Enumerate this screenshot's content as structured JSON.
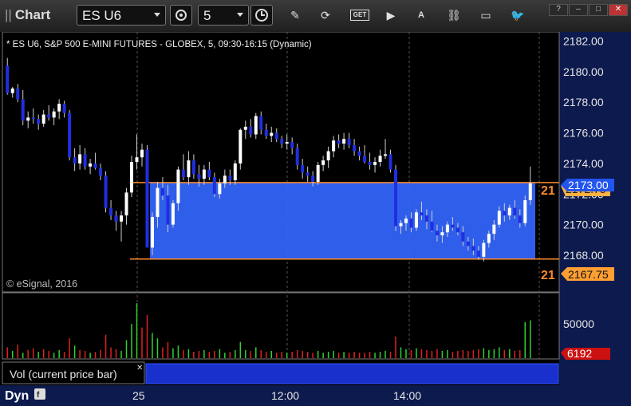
{
  "app": {
    "title": "Chart",
    "grip": "||"
  },
  "toolbar": {
    "symbol": "ES U6",
    "interval": "5",
    "icons": [
      "settings-icon",
      "clock-icon",
      "pencil-icon",
      "refresh-icon",
      "get-icon",
      "play-icon",
      "alert-icon",
      "link-icon",
      "comment-icon",
      "twitter-icon"
    ],
    "get_label": "GET",
    "alert_label": "A"
  },
  "window_buttons": [
    "?",
    "–",
    "□",
    "✕"
  ],
  "chart_header": "* ES U6, S&P 500 E-MINI FUTURES - GLOBEX, 5, 09:30-16:15 (Dynamic)",
  "copyright": "© eSignal, 2016",
  "chart_data": {
    "type": "candlestick",
    "price_axis": {
      "ticks": [
        "2182.00",
        "2180.00",
        "2178.00",
        "2176.00",
        "2174.00",
        "2172.00",
        "2170.00",
        "2168.00"
      ],
      "range": [
        2165.6,
        2182.6
      ]
    },
    "last_price": "2173.00",
    "prior_price_tag": "2172.75",
    "lower_line_label": "2167.75",
    "line_prefix": "21",
    "time_axis": [
      "25",
      "12:00",
      "14:00"
    ],
    "zone": {
      "top": 2172.75,
      "bottom": 2167.75,
      "color": "#3366ff"
    },
    "candles": [
      [
        2180.4,
        2180.9,
        2178.5,
        2178.6
      ],
      [
        2178.6,
        2179.0,
        2178.3,
        2178.9
      ],
      [
        2178.9,
        2179.2,
        2178.0,
        2178.2
      ],
      [
        2178.2,
        2178.8,
        2176.5,
        2176.8
      ],
      [
        2176.8,
        2177.4,
        2176.3,
        2177.0
      ],
      [
        2177.0,
        2177.6,
        2176.6,
        2176.9
      ],
      [
        2176.9,
        2177.2,
        2176.2,
        2176.6
      ],
      [
        2176.6,
        2177.5,
        2176.4,
        2177.2
      ],
      [
        2177.2,
        2177.8,
        2176.8,
        2177.0
      ],
      [
        2177.0,
        2177.6,
        2176.5,
        2177.4
      ],
      [
        2177.4,
        2178.2,
        2176.9,
        2177.9
      ],
      [
        2177.9,
        2178.1,
        2177.0,
        2177.3
      ],
      [
        2177.3,
        2177.5,
        2174.2,
        2174.4
      ],
      [
        2174.4,
        2175.0,
        2173.5,
        2174.0
      ],
      [
        2174.0,
        2175.2,
        2173.6,
        2174.6
      ],
      [
        2174.6,
        2175.0,
        2173.6,
        2173.8
      ],
      [
        2173.8,
        2174.3,
        2173.3,
        2174.0
      ],
      [
        2174.0,
        2174.7,
        2173.6,
        2173.7
      ],
      [
        2173.7,
        2174.0,
        2172.9,
        2173.2
      ],
      [
        2173.2,
        2173.5,
        2170.8,
        2171.1
      ],
      [
        2171.1,
        2171.6,
        2170.3,
        2170.6
      ],
      [
        2170.6,
        2170.9,
        2169.6,
        2170.2
      ],
      [
        2170.2,
        2170.9,
        2168.9,
        2170.6
      ],
      [
        2170.6,
        2172.4,
        2170.0,
        2172.1
      ],
      [
        2172.1,
        2174.5,
        2171.8,
        2174.1
      ],
      [
        2174.1,
        2175.9,
        2173.6,
        2174.4
      ],
      [
        2174.4,
        2175.3,
        2173.8,
        2174.9
      ],
      [
        2174.9,
        2175.2,
        2171.9,
        2168.5
      ],
      [
        2168.5,
        2170.8,
        2168.0,
        2170.5
      ],
      [
        2170.5,
        2172.8,
        2169.8,
        2172.4
      ],
      [
        2172.4,
        2173.1,
        2171.6,
        2171.9
      ],
      [
        2171.9,
        2172.6,
        2169.5,
        2170.0
      ],
      [
        2170.0,
        2171.6,
        2169.8,
        2171.4
      ],
      [
        2171.4,
        2173.8,
        2170.9,
        2173.6
      ],
      [
        2173.6,
        2174.6,
        2172.9,
        2173.1
      ],
      [
        2173.1,
        2174.8,
        2172.6,
        2174.2
      ],
      [
        2174.2,
        2174.6,
        2173.0,
        2173.3
      ],
      [
        2173.3,
        2173.9,
        2172.5,
        2173.0
      ],
      [
        2173.0,
        2173.9,
        2172.6,
        2173.6
      ],
      [
        2173.6,
        2174.1,
        2172.9,
        2173.1
      ],
      [
        2173.1,
        2173.4,
        2171.8,
        2172.0
      ],
      [
        2172.0,
        2173.0,
        2171.7,
        2172.7
      ],
      [
        2172.7,
        2173.6,
        2172.4,
        2173.2
      ],
      [
        2173.2,
        2173.6,
        2172.6,
        2172.9
      ],
      [
        2172.9,
        2174.2,
        2172.6,
        2174.0
      ],
      [
        2174.0,
        2176.3,
        2173.6,
        2176.2
      ],
      [
        2176.2,
        2176.8,
        2175.6,
        2176.4
      ],
      [
        2176.4,
        2176.9,
        2175.7,
        2175.9
      ],
      [
        2175.9,
        2177.3,
        2175.6,
        2177.1
      ],
      [
        2177.1,
        2177.4,
        2175.9,
        2176.2
      ],
      [
        2176.2,
        2176.6,
        2175.6,
        2175.8
      ],
      [
        2175.8,
        2176.4,
        2175.4,
        2176.0
      ],
      [
        2176.0,
        2176.3,
        2175.4,
        2175.6
      ],
      [
        2175.6,
        2175.8,
        2175.0,
        2175.3
      ],
      [
        2175.3,
        2175.9,
        2174.9,
        2175.4
      ],
      [
        2175.4,
        2175.7,
        2174.6,
        2175.0
      ],
      [
        2175.0,
        2175.3,
        2173.6,
        2173.9
      ],
      [
        2173.9,
        2174.3,
        2173.0,
        2173.4
      ],
      [
        2173.4,
        2173.8,
        2172.8,
        2173.2
      ],
      [
        2173.2,
        2173.5,
        2172.5,
        2172.8
      ],
      [
        2172.8,
        2174.1,
        2172.6,
        2173.9
      ],
      [
        2173.9,
        2174.5,
        2173.5,
        2174.2
      ],
      [
        2174.2,
        2175.1,
        2173.7,
        2174.8
      ],
      [
        2174.8,
        2175.8,
        2174.4,
        2175.5
      ],
      [
        2175.5,
        2175.9,
        2175.0,
        2175.3
      ],
      [
        2175.3,
        2176.0,
        2174.9,
        2175.6
      ],
      [
        2175.6,
        2176.0,
        2175.0,
        2175.2
      ],
      [
        2175.2,
        2175.6,
        2174.5,
        2174.8
      ],
      [
        2174.8,
        2175.1,
        2174.2,
        2174.5
      ],
      [
        2174.5,
        2175.2,
        2174.0,
        2174.1
      ],
      [
        2174.1,
        2174.7,
        2173.6,
        2173.9
      ],
      [
        2173.9,
        2174.4,
        2173.4,
        2174.1
      ],
      [
        2174.1,
        2174.9,
        2173.8,
        2174.5
      ],
      [
        2174.5,
        2175.6,
        2174.3,
        2174.6
      ],
      [
        2174.6,
        2174.9,
        2173.4,
        2173.6
      ],
      [
        2173.6,
        2173.9,
        2169.6,
        2169.9
      ],
      [
        2169.9,
        2170.3,
        2169.4,
        2170.1
      ],
      [
        2170.1,
        2170.6,
        2169.6,
        2170.4
      ],
      [
        2170.4,
        2170.8,
        2169.5,
        2169.8
      ],
      [
        2169.8,
        2171.0,
        2169.6,
        2170.8
      ],
      [
        2170.8,
        2171.5,
        2170.3,
        2170.6
      ],
      [
        2170.6,
        2171.0,
        2169.7,
        2170.2
      ],
      [
        2170.2,
        2170.9,
        2169.5,
        2169.6
      ],
      [
        2169.6,
        2170.0,
        2168.9,
        2169.3
      ],
      [
        2169.3,
        2169.9,
        2168.8,
        2169.5
      ],
      [
        2169.5,
        2170.2,
        2169.2,
        2170.0
      ],
      [
        2170.0,
        2170.5,
        2169.6,
        2169.8
      ],
      [
        2169.8,
        2170.1,
        2169.3,
        2169.5
      ],
      [
        2169.5,
        2169.9,
        2168.6,
        2168.9
      ],
      [
        2168.9,
        2169.2,
        2168.3,
        2168.6
      ],
      [
        2168.6,
        2169.1,
        2168.0,
        2168.3
      ],
      [
        2168.3,
        2168.6,
        2167.7,
        2167.9
      ],
      [
        2167.9,
        2169.0,
        2167.6,
        2168.8
      ],
      [
        2168.8,
        2169.6,
        2168.5,
        2169.4
      ],
      [
        2169.4,
        2170.3,
        2169.0,
        2170.0
      ],
      [
        2170.0,
        2171.2,
        2169.8,
        2170.9
      ],
      [
        2170.9,
        2171.4,
        2170.2,
        2170.6
      ],
      [
        2170.6,
        2171.3,
        2170.3,
        2171.1
      ],
      [
        2171.1,
        2171.6,
        2170.4,
        2170.6
      ],
      [
        2170.6,
        2171.0,
        2169.8,
        2170.1
      ],
      [
        2170.1,
        2171.9,
        2169.9,
        2171.6
      ],
      [
        2171.6,
        2173.8,
        2171.3,
        2172.7
      ]
    ],
    "volume_axis": {
      "ticks": [
        "50000"
      ],
      "max": 70000
    },
    "volume_last": "6192",
    "volume_label": "Vol (current price bar)",
    "volume_bars": [
      [
        12000,
        "r"
      ],
      [
        8000,
        "g"
      ],
      [
        15000,
        "r"
      ],
      [
        6000,
        "g"
      ],
      [
        9000,
        "r"
      ],
      [
        11000,
        "r"
      ],
      [
        7000,
        "g"
      ],
      [
        10000,
        "r"
      ],
      [
        8000,
        "r"
      ],
      [
        6000,
        "g"
      ],
      [
        9000,
        "g"
      ],
      [
        7000,
        "r"
      ],
      [
        22000,
        "r"
      ],
      [
        14000,
        "g"
      ],
      [
        9000,
        "r"
      ],
      [
        8000,
        "r"
      ],
      [
        6000,
        "g"
      ],
      [
        7000,
        "r"
      ],
      [
        9000,
        "r"
      ],
      [
        26000,
        "r"
      ],
      [
        12000,
        "r"
      ],
      [
        10000,
        "r"
      ],
      [
        8000,
        "g"
      ],
      [
        20000,
        "g"
      ],
      [
        38000,
        "g"
      ],
      [
        61000,
        "g"
      ],
      [
        34000,
        "r"
      ],
      [
        48000,
        "r"
      ],
      [
        28000,
        "g"
      ],
      [
        22000,
        "g"
      ],
      [
        12000,
        "r"
      ],
      [
        18000,
        "r"
      ],
      [
        11000,
        "g"
      ],
      [
        14000,
        "g"
      ],
      [
        9000,
        "r"
      ],
      [
        10000,
        "g"
      ],
      [
        7000,
        "r"
      ],
      [
        8000,
        "r"
      ],
      [
        9000,
        "g"
      ],
      [
        7000,
        "r"
      ],
      [
        8000,
        "r"
      ],
      [
        10000,
        "g"
      ],
      [
        6000,
        "g"
      ],
      [
        7000,
        "r"
      ],
      [
        9000,
        "g"
      ],
      [
        18000,
        "g"
      ],
      [
        9000,
        "g"
      ],
      [
        8000,
        "r"
      ],
      [
        12000,
        "g"
      ],
      [
        9000,
        "r"
      ],
      [
        7000,
        "r"
      ],
      [
        8000,
        "g"
      ],
      [
        6000,
        "r"
      ],
      [
        7000,
        "r"
      ],
      [
        6000,
        "g"
      ],
      [
        7000,
        "r"
      ],
      [
        9000,
        "r"
      ],
      [
        8000,
        "r"
      ],
      [
        7000,
        "r"
      ],
      [
        6000,
        "r"
      ],
      [
        8000,
        "g"
      ],
      [
        6000,
        "g"
      ],
      [
        7000,
        "g"
      ],
      [
        8000,
        "g"
      ],
      [
        6000,
        "r"
      ],
      [
        7000,
        "g"
      ],
      [
        6000,
        "r"
      ],
      [
        7000,
        "r"
      ],
      [
        6000,
        "r"
      ],
      [
        6000,
        "r"
      ],
      [
        7000,
        "r"
      ],
      [
        6000,
        "g"
      ],
      [
        7000,
        "g"
      ],
      [
        8000,
        "g"
      ],
      [
        7000,
        "r"
      ],
      [
        24000,
        "r"
      ],
      [
        12000,
        "g"
      ],
      [
        10000,
        "g"
      ],
      [
        9000,
        "r"
      ],
      [
        11000,
        "g"
      ],
      [
        10000,
        "r"
      ],
      [
        9000,
        "r"
      ],
      [
        8000,
        "r"
      ],
      [
        10000,
        "r"
      ],
      [
        8000,
        "g"
      ],
      [
        9000,
        "g"
      ],
      [
        7000,
        "r"
      ],
      [
        8000,
        "r"
      ],
      [
        9000,
        "r"
      ],
      [
        8000,
        "r"
      ],
      [
        9000,
        "r"
      ],
      [
        10000,
        "r"
      ],
      [
        11000,
        "g"
      ],
      [
        9000,
        "g"
      ],
      [
        10000,
        "g"
      ],
      [
        12000,
        "g"
      ],
      [
        9000,
        "r"
      ],
      [
        10000,
        "g"
      ],
      [
        8000,
        "r"
      ],
      [
        9000,
        "r"
      ],
      [
        40000,
        "g"
      ],
      [
        42000,
        "g"
      ]
    ]
  },
  "footer": {
    "dyn": "Dyn",
    "lock": "f"
  }
}
